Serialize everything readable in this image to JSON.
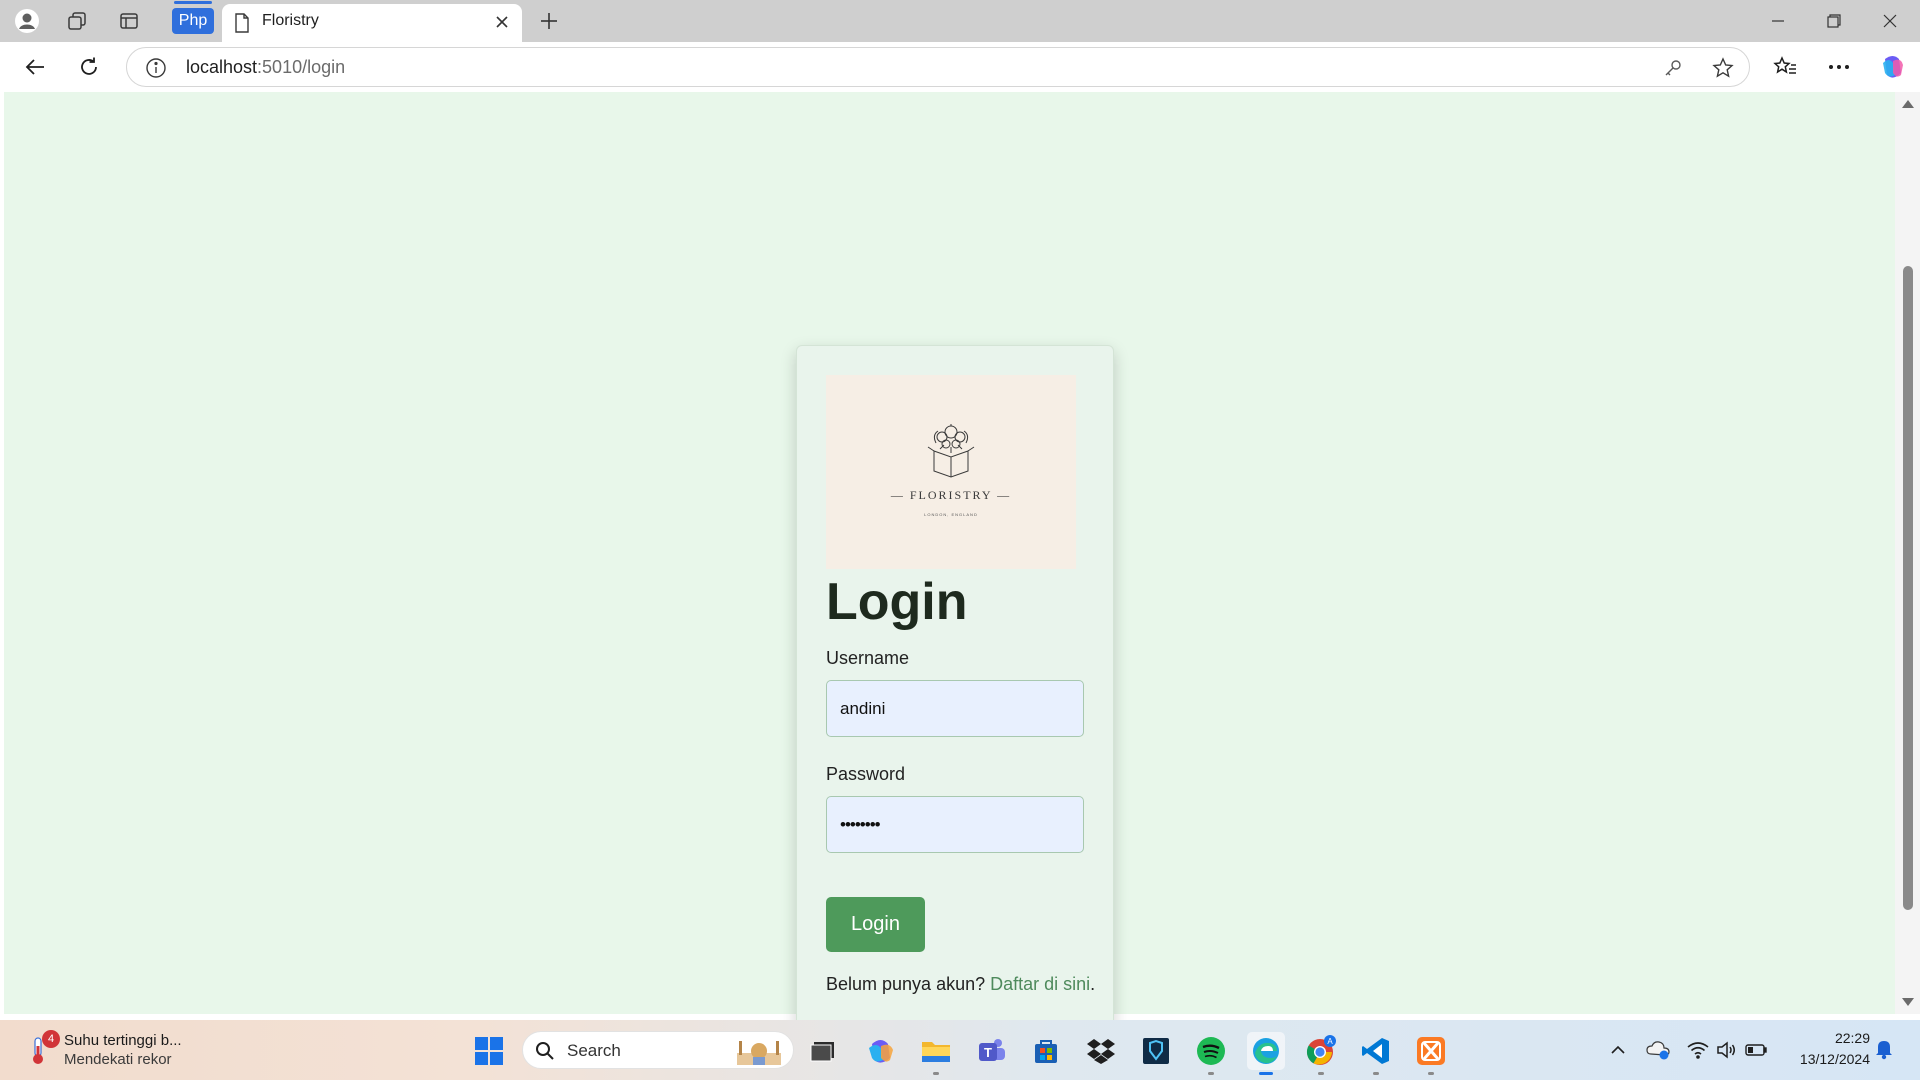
{
  "browser": {
    "tab_title": "Floristry",
    "pinned_tab_label": "Php",
    "url_host": "localhost",
    "url_path": ":5010/login"
  },
  "logo": {
    "name": "FLORISTRY",
    "tagline": "LONDON, ENGLAND"
  },
  "form": {
    "title": "Login",
    "username_label": "Username",
    "username_value": "andini",
    "password_label": "Password",
    "password_value": "••••••••",
    "submit_label": "Login",
    "signup_prompt": "Belum punya akun?",
    "signup_link": "Daftar di sini",
    "signup_period": "."
  },
  "taskbar": {
    "weather_badge": "4",
    "weather_title": "Suhu tertinggi b...",
    "weather_subtitle": "Mendekati rekor",
    "search_placeholder": "Search",
    "time": "22:29",
    "date": "13/12/2024"
  },
  "colors": {
    "page_background": "#e8f7ea",
    "button": "#4e9a5b",
    "link": "#4e8a5c",
    "input_background": "#e8f0fe"
  }
}
